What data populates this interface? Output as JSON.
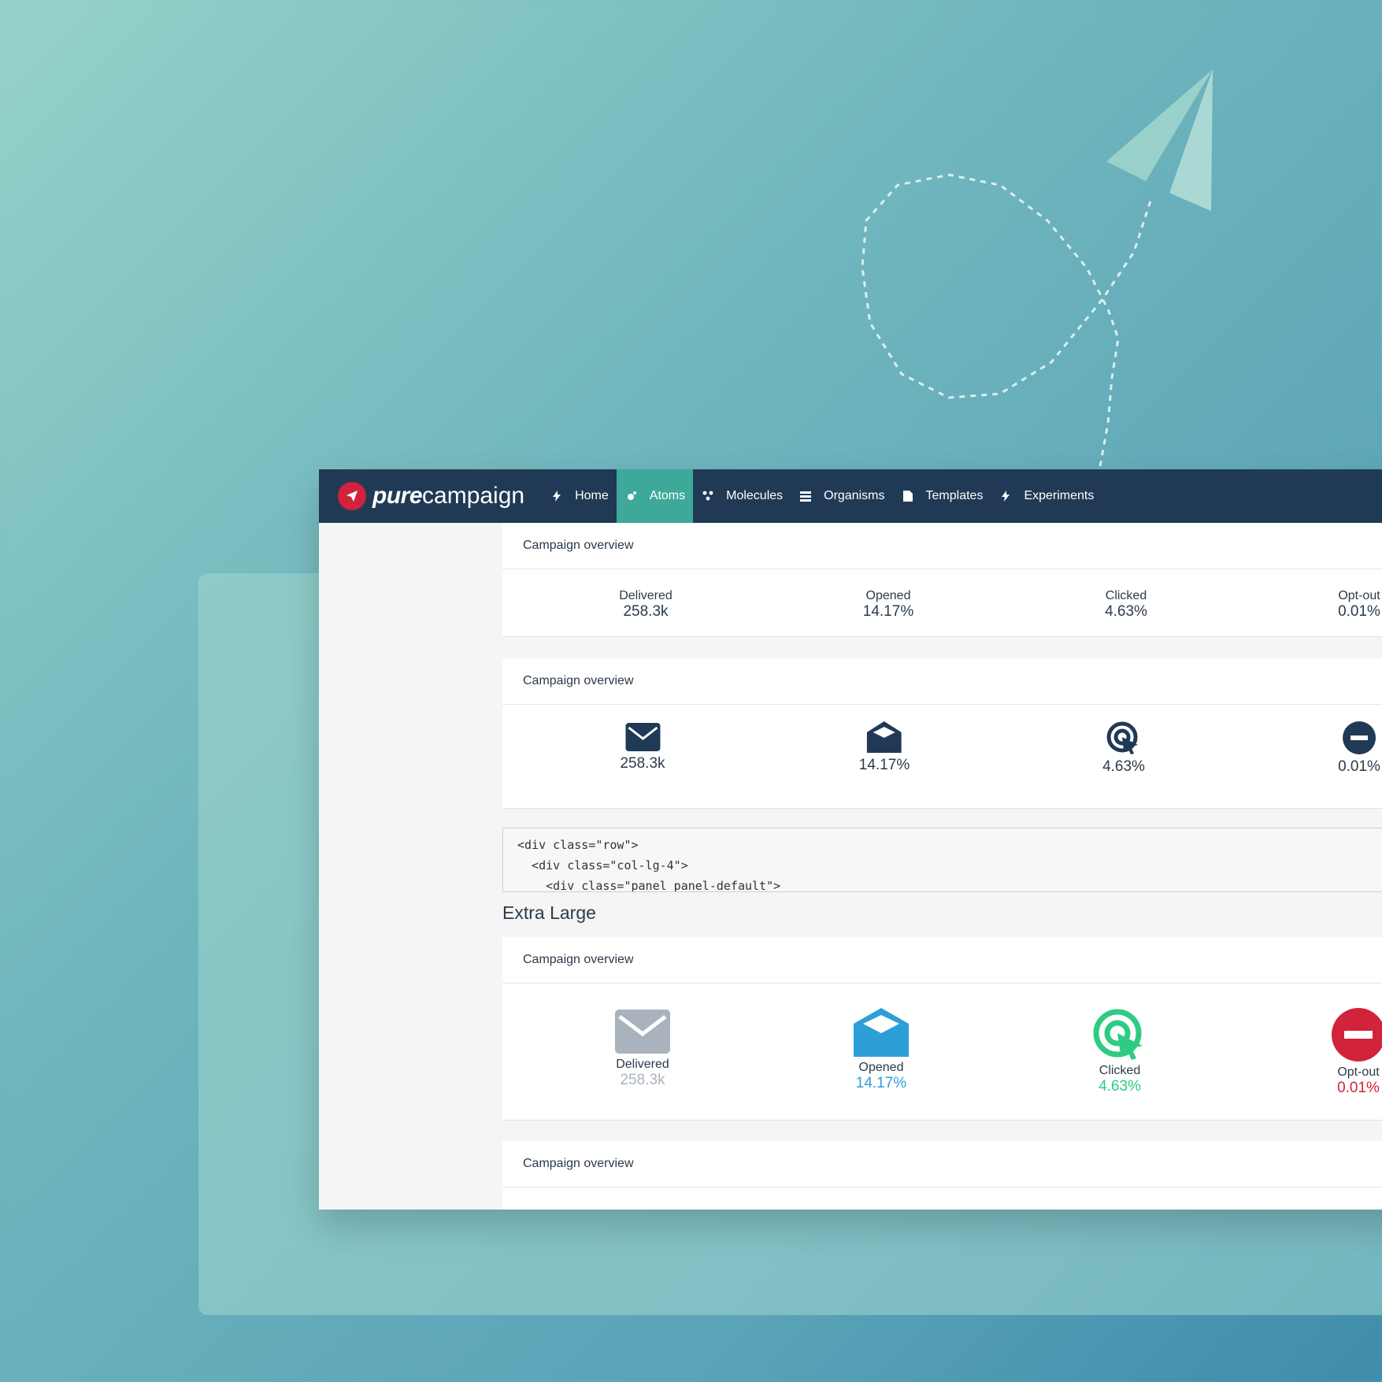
{
  "colors": {
    "navbar": "#203a55",
    "nav_active": "#3ea99a",
    "brand_red": "#d2233c",
    "dark_icon": "#203a55",
    "delivered_gray": "#a9b3be",
    "opened_blue": "#2e9fd6",
    "clicked_green": "#2ecc82",
    "optout_red": "#d2233c"
  },
  "logo": {
    "pure": "pure",
    "campaign": "campaign",
    "icon": "paper-plane-icon"
  },
  "nav": [
    {
      "label": "Home",
      "icon": "bolt-icon"
    },
    {
      "label": "Atoms",
      "icon": "atom-icon",
      "active": true
    },
    {
      "label": "Molecules",
      "icon": "molecule-icon"
    },
    {
      "label": "Organisms",
      "icon": "organism-icon"
    },
    {
      "label": "Templates",
      "icon": "file-icon"
    },
    {
      "label": "Experiments",
      "icon": "bolt-icon"
    }
  ],
  "panel1": {
    "title": "Campaign overview",
    "stats": [
      {
        "label": "Delivered",
        "value": "258.3k"
      },
      {
        "label": "Opened",
        "value": "14.17%"
      },
      {
        "label": "Clicked",
        "value": "4.63%"
      },
      {
        "label": "Opt-out",
        "value": "0.01%"
      }
    ]
  },
  "panel2": {
    "title": "Campaign overview",
    "stats": [
      {
        "icon": "envelope-icon",
        "value": "258.3k"
      },
      {
        "icon": "envelope-open-icon",
        "value": "14.17%"
      },
      {
        "icon": "target-click-icon",
        "value": "4.63%"
      },
      {
        "icon": "minus-circle-icon",
        "value": "0.01%"
      }
    ]
  },
  "code": {
    "lines": [
      "<div class=\"row\">",
      "  <div class=\"col-lg-4\">",
      "    <div class=\"panel panel-default\">"
    ]
  },
  "section_title": "Extra Large",
  "panel3": {
    "title": "Campaign overview",
    "stats": [
      {
        "icon": "envelope-icon",
        "label": "Delivered",
        "value": "258.3k"
      },
      {
        "icon": "envelope-open-icon",
        "label": "Opened",
        "value": "14.17%"
      },
      {
        "icon": "target-click-icon",
        "label": "Clicked",
        "value": "4.63%"
      },
      {
        "icon": "minus-circle-icon",
        "label": "Opt-out",
        "value": "0.01%"
      }
    ]
  },
  "panel4": {
    "title": "Campaign overview"
  }
}
